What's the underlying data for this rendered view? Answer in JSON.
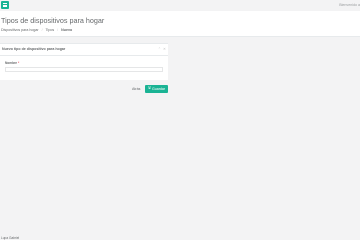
{
  "topbar": {
    "menu_icon": "hamburger-icon",
    "right_text": "Bienvenido a"
  },
  "page_heading": {
    "title": "Tipos de dispositivos para hogar",
    "breadcrumbs": [
      {
        "label": "Dispositivos para hogar"
      },
      {
        "label": "Tipos"
      },
      {
        "label": "Nuevo"
      }
    ]
  },
  "panel": {
    "title": "Nuevo tipo de dispositivo para hogar",
    "tools": [
      "chevron-up-icon",
      "close-icon"
    ],
    "field": {
      "label": "Nombre",
      "required_marker": "*",
      "value": "",
      "placeholder": ""
    }
  },
  "actions": {
    "back_label": "Atrás",
    "save_label": "Guardar",
    "save_icon": "save-icon"
  },
  "footer": {
    "text": "Lupa Gabriel"
  },
  "colors": {
    "accent": "#1ab394",
    "required": "#ed5565"
  }
}
